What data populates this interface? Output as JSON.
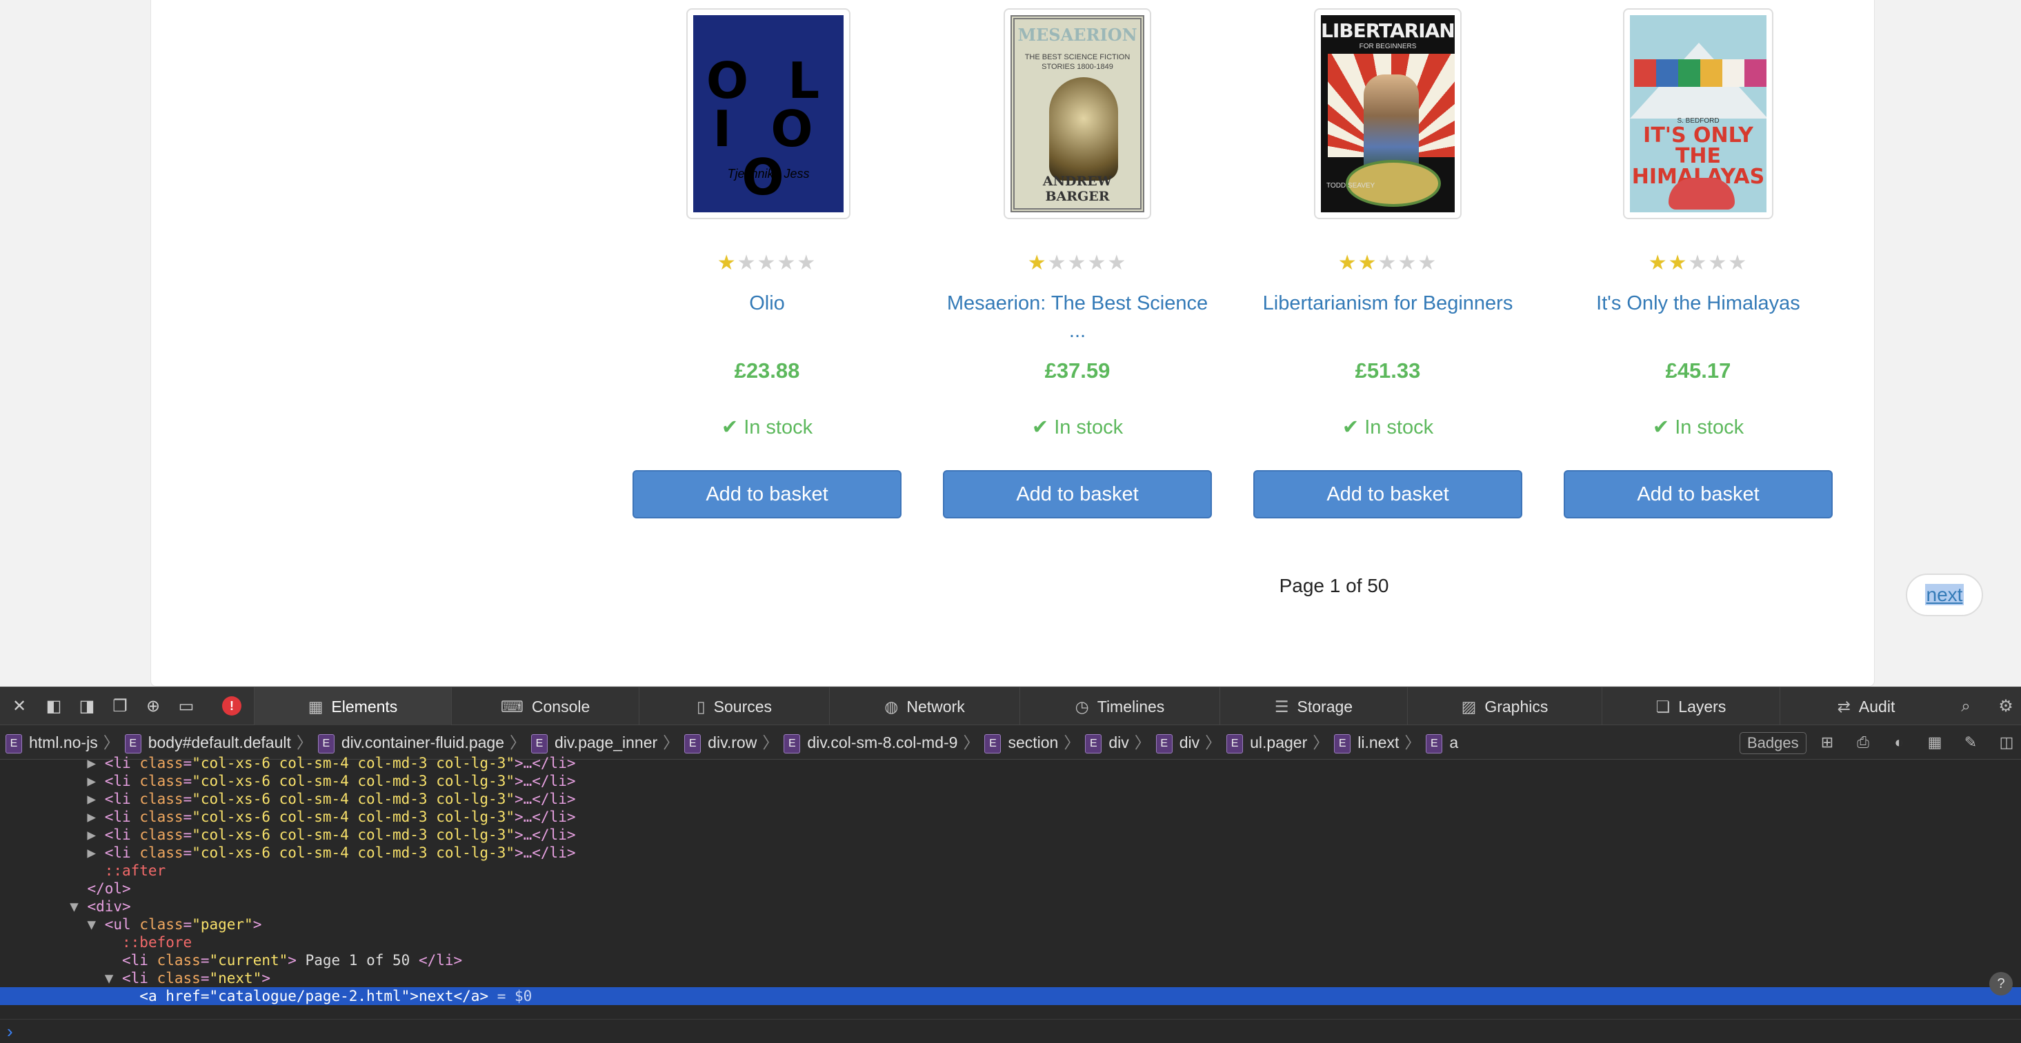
{
  "products": [
    {
      "title": "Olio",
      "price": "£23.88",
      "rating": 1,
      "stock": "In stock",
      "cover_text": "OLIO",
      "cover_author": "Tjefinnika Jess"
    },
    {
      "title": "Mesaerion: The Best Science ...",
      "price": "£37.59",
      "rating": 1,
      "stock": "In stock",
      "cover_text": "MESAERION",
      "cover_subtitle": "THE BEST SCIENCE FICTION STORIES 1800-1849",
      "cover_author": "ANDREW BARGER"
    },
    {
      "title": "Libertarianism for Beginners",
      "price": "£51.33",
      "rating": 2,
      "stock": "In stock",
      "cover_text": "LIBERTARIANISM",
      "cover_subtitle": "FOR BEGINNERS",
      "cover_author": "TODD SEAVEY"
    },
    {
      "title": "It's Only the Himalayas",
      "price": "£45.17",
      "rating": 2,
      "stock": "In stock",
      "cover_text": "IT'S ONLY THE HIMALAYAS",
      "cover_author": "S. BEDFORD"
    }
  ],
  "add_to_basket_label": "Add to basket",
  "pager": {
    "current": "Page 1 of 50",
    "next": "next"
  },
  "devtools": {
    "tabs": [
      "Elements",
      "Console",
      "Sources",
      "Network",
      "Timelines",
      "Storage",
      "Graphics",
      "Layers",
      "Audit"
    ],
    "active_tab": "Elements",
    "breadcrumbs": [
      "html.no-js",
      "body#default.default",
      "div.container-fluid.page",
      "div.page_inner",
      "div.row",
      "div.col-sm-8.col-md-9",
      "section",
      "div",
      "div",
      "ul.pager",
      "li.next",
      "a"
    ],
    "badges_label": "Badges",
    "dom": {
      "li_open": "<li",
      "class_attr": "class",
      "li_class_value": "\"col-xs-6 col-sm-4 col-md-3 col-lg-3\"",
      "li_tail": ">…</li>",
      "after": "::after",
      "ol_close": "</ol>",
      "div_open": "<div>",
      "ul_open": "<ul",
      "ul_class_value": "\"pager\"",
      "before": "::before",
      "li_current_value": "\"current\"",
      "li_current_text": " Page 1 of 50 ",
      "li_close": "</li>",
      "li_next_value": "\"next\"",
      "a_open": "<a",
      "href_attr": "href",
      "href_value": "\"catalogue/page-2.html\"",
      "a_text": "next",
      "a_close": "</a>",
      "dollar": "= $0"
    },
    "colors": {
      "selected_row": "#2357c4",
      "tag": "#e6a0e0",
      "attr": "#f0a860",
      "value": "#f7e06a"
    }
  },
  "icons": [
    "close-icon",
    "dock-left-icon",
    "dock-bottom-icon",
    "undock-icon",
    "element-picker-icon",
    "device-icon",
    "error-icon",
    "search-icon",
    "settings-icon",
    "help-icon"
  ]
}
